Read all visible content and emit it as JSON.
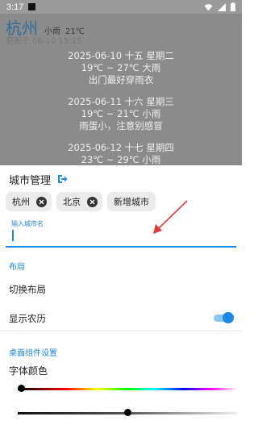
{
  "status_bar": {
    "time": "3:17"
  },
  "background": {
    "city": "杭州",
    "weather": "小雨",
    "temp": "21℃",
    "updated_at": "更新于 06-10 15:15",
    "forecast": [
      {
        "date_line": "2025-06-10 十五 星期二",
        "temp_line": "19℃ ~ 27℃ 大雨",
        "tip": "出门最好穿雨衣"
      },
      {
        "date_line": "2025-06-11 十六 星期三",
        "temp_line": "19℃ ~ 21℃ 小雨",
        "tip": "雨蛋小，注意别感冒"
      },
      {
        "date_line": "2025-06-12 十七 星期四",
        "temp_line": "23℃ ~ 29℃ 小雨",
        "tip": ""
      }
    ]
  },
  "sheet": {
    "title": "城市管理",
    "chips": [
      {
        "label": "杭州"
      },
      {
        "label": "北京"
      }
    ],
    "add_chip_label": "新增城市",
    "input": {
      "label": "输入城市名",
      "value": ""
    },
    "layout_section_label": "布局",
    "switch_layout_label": "切换布局",
    "show_lunar_label": "显示农历",
    "show_lunar_on": true,
    "widget_section_label": "桌面组件设置",
    "font_color_label": "字体颜色",
    "font_color_value": 0.0,
    "brightness_value": 0.5
  },
  "colors": {
    "accent": "#1e88e5",
    "annotation_arrow": "#e53935"
  }
}
